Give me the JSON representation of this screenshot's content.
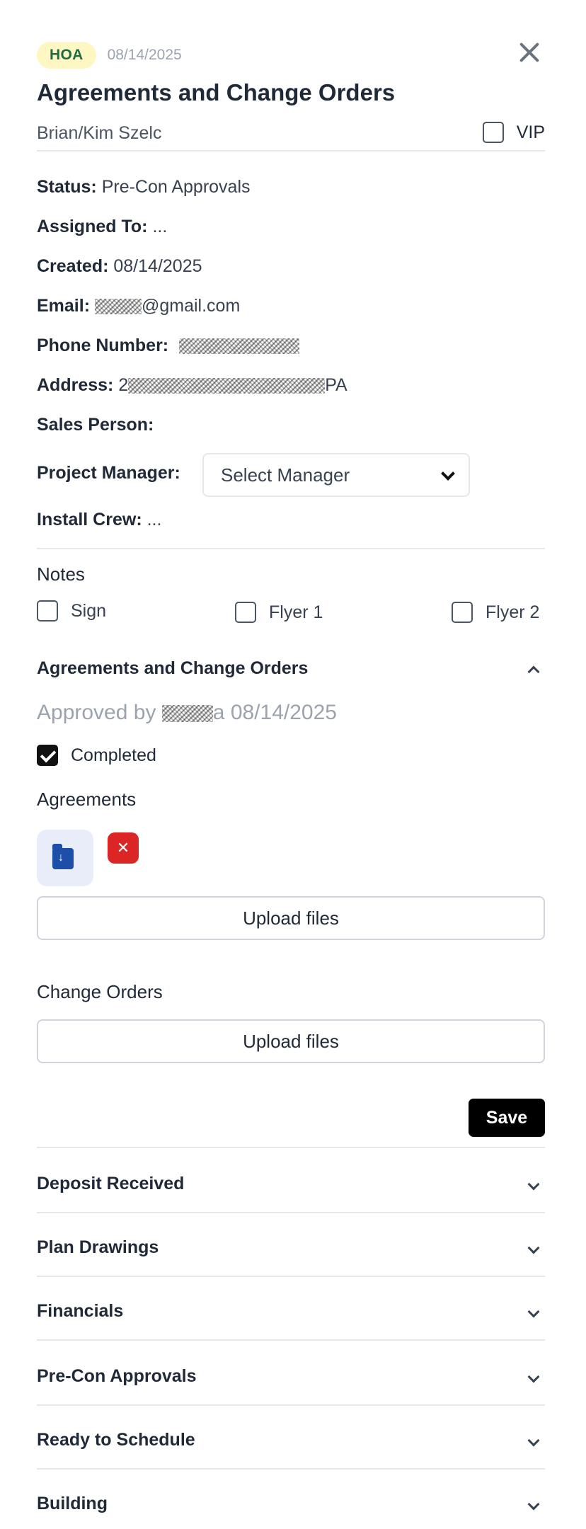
{
  "header": {
    "tag": "HOA",
    "date": "08/14/2025",
    "title": "Agreements and Change Orders",
    "client": "Brian/Kim Szelc",
    "vip_label": "VIP"
  },
  "fields": {
    "status_label": "Status:",
    "status_value": "Pre-Con Approvals",
    "assigned_label": "Assigned To:",
    "assigned_value": "...",
    "created_label": "Created:",
    "created_value": "08/14/2025",
    "email_label": "Email:",
    "email_value": "@gmail.com",
    "phone_label": "Phone Number:",
    "address_label": "Address:",
    "address_prefix": "2",
    "address_suffix": "PA",
    "sales_label": "Sales Person:",
    "pm_label": "Project Manager:",
    "pm_placeholder": "Select Manager",
    "crew_label": "Install Crew:",
    "crew_value": "..."
  },
  "notes": {
    "title": "Notes",
    "options": [
      {
        "label": "Sign",
        "checked": false
      },
      {
        "label": "Flyer 1",
        "checked": false
      },
      {
        "label": "Flyer 2",
        "checked": false
      }
    ]
  },
  "agreements_section": {
    "title": "Agreements and Change Orders",
    "approved_prefix": "Approved by",
    "approved_suffix": "a 08/14/2025",
    "completed_label": "Completed",
    "completed_checked": true,
    "agreements_label": "Agreements",
    "upload_label": "Upload files",
    "change_orders_label": "Change Orders",
    "upload_label_2": "Upload files",
    "save_label": "Save",
    "delete_glyph": "✕"
  },
  "sections": [
    {
      "title": "Deposit Received"
    },
    {
      "title": "Plan Drawings"
    },
    {
      "title": "Financials"
    },
    {
      "title": "Pre-Con Approvals"
    },
    {
      "title": "Ready to Schedule"
    },
    {
      "title": "Building"
    }
  ]
}
